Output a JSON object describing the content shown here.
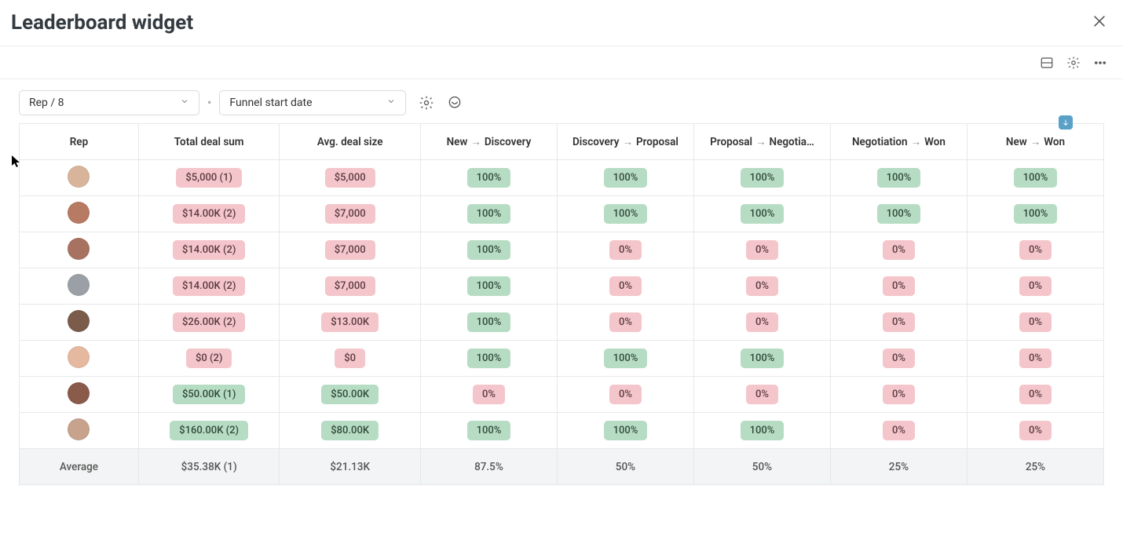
{
  "header": {
    "title": "Leaderboard widget"
  },
  "controls": {
    "select_rep": "Rep / 8",
    "select_date": "Funnel start date"
  },
  "columns": {
    "rep": "Rep",
    "total": "Total deal sum",
    "avg": "Avg. deal size",
    "stage1_from": "New",
    "stage1_to": "Discovery",
    "stage2_from": "Discovery",
    "stage2_to": "Proposal",
    "stage3_from": "Proposal",
    "stage3_to": "Negotia…",
    "stage4_from": "Negotiation",
    "stage4_to": "Won",
    "stage5_from": "New",
    "stage5_to": "Won"
  },
  "rows": [
    {
      "avatar_color": "#d8b49a",
      "total": {
        "text": "$5,000 (1)",
        "style": "pink"
      },
      "avg": {
        "text": "$5,000",
        "style": "pink"
      },
      "s1": {
        "text": "100%",
        "style": "green"
      },
      "s2": {
        "text": "100%",
        "style": "green"
      },
      "s3": {
        "text": "100%",
        "style": "green"
      },
      "s4": {
        "text": "100%",
        "style": "green"
      },
      "s5": {
        "text": "100%",
        "style": "green"
      }
    },
    {
      "avatar_color": "#b77a62",
      "total": {
        "text": "$14.00K (2)",
        "style": "pink"
      },
      "avg": {
        "text": "$7,000",
        "style": "pink"
      },
      "s1": {
        "text": "100%",
        "style": "green"
      },
      "s2": {
        "text": "100%",
        "style": "green"
      },
      "s3": {
        "text": "100%",
        "style": "green"
      },
      "s4": {
        "text": "100%",
        "style": "green"
      },
      "s5": {
        "text": "100%",
        "style": "green"
      }
    },
    {
      "avatar_color": "#a87260",
      "total": {
        "text": "$14.00K (2)",
        "style": "pink"
      },
      "avg": {
        "text": "$7,000",
        "style": "pink"
      },
      "s1": {
        "text": "100%",
        "style": "green"
      },
      "s2": {
        "text": "0%",
        "style": "pink"
      },
      "s3": {
        "text": "0%",
        "style": "pink"
      },
      "s4": {
        "text": "0%",
        "style": "pink"
      },
      "s5": {
        "text": "0%",
        "style": "pink"
      }
    },
    {
      "avatar_color": "#9aa0a6",
      "total": {
        "text": "$14.00K (2)",
        "style": "pink"
      },
      "avg": {
        "text": "$7,000",
        "style": "pink"
      },
      "s1": {
        "text": "100%",
        "style": "green"
      },
      "s2": {
        "text": "0%",
        "style": "pink"
      },
      "s3": {
        "text": "0%",
        "style": "pink"
      },
      "s4": {
        "text": "0%",
        "style": "pink"
      },
      "s5": {
        "text": "0%",
        "style": "pink"
      }
    },
    {
      "avatar_color": "#7b5c4a",
      "total": {
        "text": "$26.00K (2)",
        "style": "pink"
      },
      "avg": {
        "text": "$13.00K",
        "style": "pink"
      },
      "s1": {
        "text": "100%",
        "style": "green"
      },
      "s2": {
        "text": "0%",
        "style": "pink"
      },
      "s3": {
        "text": "0%",
        "style": "pink"
      },
      "s4": {
        "text": "0%",
        "style": "pink"
      },
      "s5": {
        "text": "0%",
        "style": "pink"
      }
    },
    {
      "avatar_color": "#e5b9a0",
      "total": {
        "text": "$0 (2)",
        "style": "pink"
      },
      "avg": {
        "text": "$0",
        "style": "pink"
      },
      "s1": {
        "text": "100%",
        "style": "green"
      },
      "s2": {
        "text": "100%",
        "style": "green"
      },
      "s3": {
        "text": "100%",
        "style": "green"
      },
      "s4": {
        "text": "0%",
        "style": "pink"
      },
      "s5": {
        "text": "0%",
        "style": "pink"
      }
    },
    {
      "avatar_color": "#8a5a4a",
      "total": {
        "text": "$50.00K (1)",
        "style": "green"
      },
      "avg": {
        "text": "$50.00K",
        "style": "green"
      },
      "s1": {
        "text": "0%",
        "style": "pink"
      },
      "s2": {
        "text": "0%",
        "style": "pink"
      },
      "s3": {
        "text": "0%",
        "style": "pink"
      },
      "s4": {
        "text": "0%",
        "style": "pink"
      },
      "s5": {
        "text": "0%",
        "style": "pink"
      }
    },
    {
      "avatar_color": "#c7a38e",
      "total": {
        "text": "$160.00K (2)",
        "style": "green"
      },
      "avg": {
        "text": "$80.00K",
        "style": "green"
      },
      "s1": {
        "text": "100%",
        "style": "green"
      },
      "s2": {
        "text": "100%",
        "style": "green"
      },
      "s3": {
        "text": "100%",
        "style": "green"
      },
      "s4": {
        "text": "0%",
        "style": "pink"
      },
      "s5": {
        "text": "0%",
        "style": "pink"
      }
    }
  ],
  "footer": {
    "label": "Average",
    "total": "$35.38K (1)",
    "avg": "$21.13K",
    "s1": "87.5%",
    "s2": "50%",
    "s3": "50%",
    "s4": "25%",
    "s5": "25%"
  }
}
